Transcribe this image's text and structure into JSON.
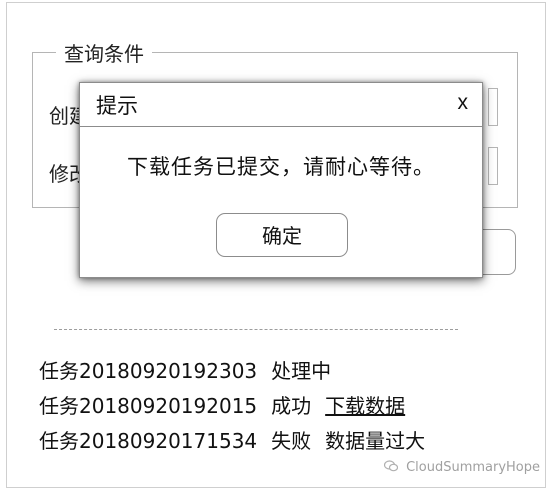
{
  "query_panel": {
    "legend": "查询条件",
    "field1_label": "创建",
    "field2_label": "修改"
  },
  "tasks": [
    {
      "name": "任务20180920192303",
      "status": "处理中",
      "extra": ""
    },
    {
      "name": "任务20180920192015",
      "status": "成功",
      "extra": "下载数据"
    },
    {
      "name": "任务20180920171534",
      "status": "失败",
      "extra": "数据量过大"
    }
  ],
  "dialog": {
    "title": "提示",
    "close": "x",
    "message": "下载任务已提交，请耐心等待。",
    "ok_label": "确定"
  },
  "watermark": {
    "icon": "wechat-icon",
    "text": "CloudSummaryHope"
  }
}
